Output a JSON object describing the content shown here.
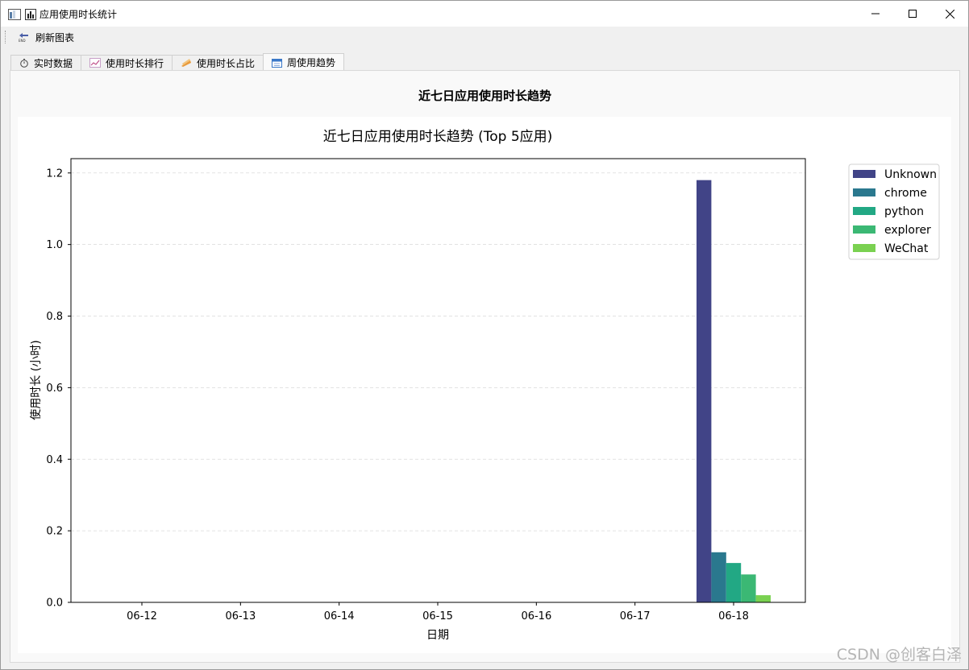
{
  "window": {
    "title": "应用使用时长统计",
    "controls": [
      "minimize",
      "maximize",
      "close"
    ]
  },
  "toolbar": {
    "refresh_label": "刷新图表",
    "refresh_icon": "refresh-icon"
  },
  "tabs": [
    {
      "label": "实时数据",
      "icon": "stopwatch-icon"
    },
    {
      "label": "使用时长排行",
      "icon": "line-chart-icon"
    },
    {
      "label": "使用时长占比",
      "icon": "pie-icon"
    },
    {
      "label": "周使用趋势",
      "icon": "calendar-icon",
      "active": true
    }
  ],
  "panel": {
    "title": "近七日应用使用时长趋势"
  },
  "watermark": "CSDN @创客白泽",
  "chart_data": {
    "type": "bar",
    "title": "近七日应用使用时长趋势 (Top 5应用)",
    "xlabel": "日期",
    "ylabel": "使用时长 (小时)",
    "categories": [
      "06-12",
      "06-13",
      "06-14",
      "06-15",
      "06-16",
      "06-17",
      "06-18"
    ],
    "ylim": [
      0,
      1.24
    ],
    "yticks": [
      0.0,
      0.2,
      0.4,
      0.6,
      0.8,
      1.0,
      1.2
    ],
    "ytick_labels": [
      "0.0",
      "0.2",
      "0.4",
      "0.6",
      "0.8",
      "1.0",
      "1.2"
    ],
    "grid": "horizontal-dashed",
    "legend_position": "outside-top-right",
    "series": [
      {
        "name": "Unknown",
        "color": "#414487",
        "values": [
          0,
          0,
          0,
          0,
          0,
          0,
          1.18
        ]
      },
      {
        "name": "chrome",
        "color": "#2a788e",
        "values": [
          0,
          0,
          0,
          0,
          0,
          0,
          0.14
        ]
      },
      {
        "name": "python",
        "color": "#22a884",
        "values": [
          0,
          0,
          0,
          0,
          0,
          0,
          0.11
        ]
      },
      {
        "name": "explorer",
        "color": "#3bb874",
        "values": [
          0,
          0,
          0,
          0,
          0,
          0,
          0.078
        ]
      },
      {
        "name": "WeChat",
        "color": "#7ad151",
        "values": [
          0,
          0,
          0,
          0,
          0,
          0,
          0.02
        ]
      }
    ]
  }
}
